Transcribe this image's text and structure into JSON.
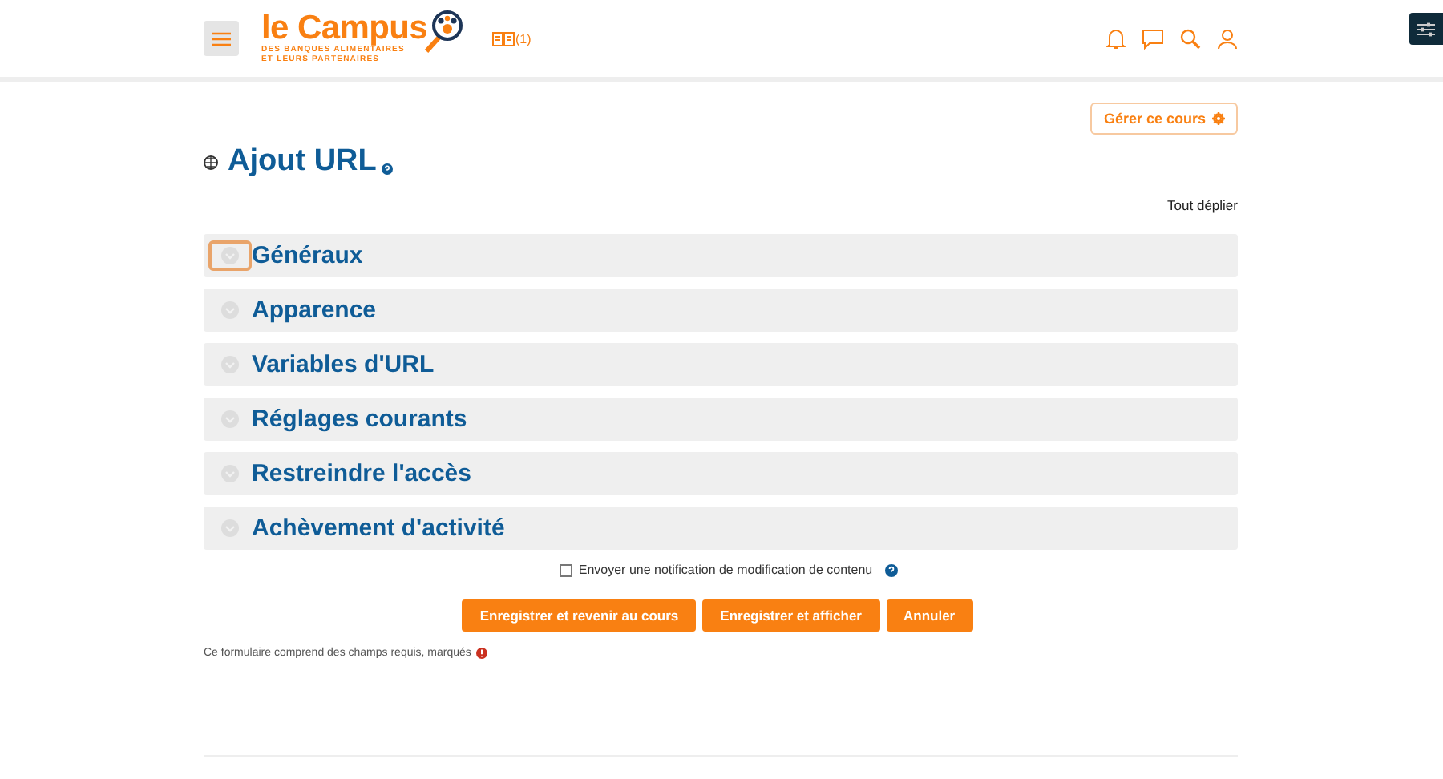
{
  "header": {
    "logo": {
      "title": "le Campus",
      "subtitle": [
        "DES BANQUES ALIMENTAIRES",
        "ET LEURS PARTENAIRES"
      ]
    },
    "badge": "(1)"
  },
  "manage_button": "Gérer ce cours",
  "page_title": "Ajout URL",
  "expand_all": "Tout déplier",
  "sections": [
    {
      "title": "Généraux",
      "expanded": false,
      "focused": true
    },
    {
      "title": "Apparence",
      "expanded": false,
      "focused": false
    },
    {
      "title": "Variables d'URL",
      "expanded": false,
      "focused": false
    },
    {
      "title": "Réglages courants",
      "expanded": false,
      "focused": false
    },
    {
      "title": "Restreindre l'accès",
      "expanded": false,
      "focused": false
    },
    {
      "title": "Achèvement d'activité",
      "expanded": false,
      "focused": false
    }
  ],
  "notify": {
    "label": "Envoyer une notification de modification de contenu",
    "checked": false
  },
  "buttons": [
    "Enregistrer et revenir au cours",
    "Enregistrer et afficher",
    "Annuler"
  ],
  "required_note": "Ce formulaire comprend des champs requis, marqués"
}
